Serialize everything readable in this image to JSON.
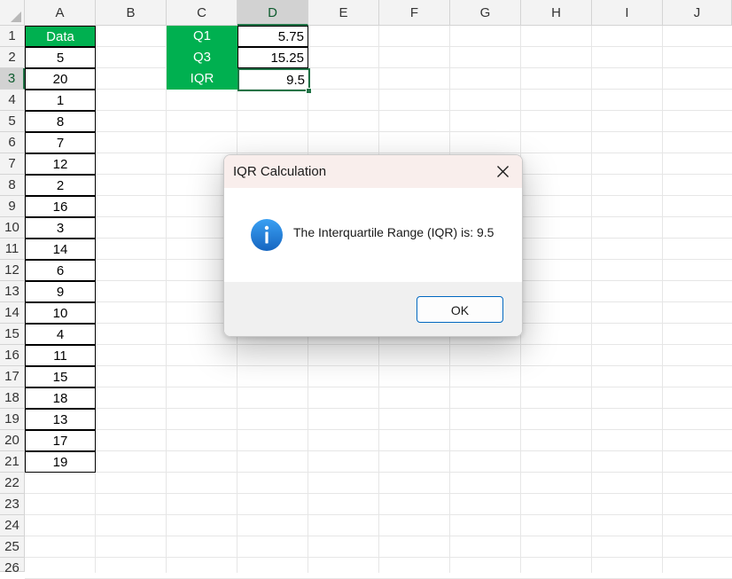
{
  "spreadsheet": {
    "columns": [
      "A",
      "B",
      "C",
      "D",
      "E",
      "F",
      "G",
      "H",
      "I",
      "J"
    ],
    "selected_column": "D",
    "rows": [
      "1",
      "2",
      "3",
      "4",
      "5",
      "6",
      "7",
      "8",
      "9",
      "10",
      "11",
      "12",
      "13",
      "14",
      "15",
      "16",
      "17",
      "18",
      "19",
      "20",
      "21",
      "22",
      "23",
      "24",
      "25",
      "26"
    ],
    "selected_row": "3",
    "column_a": {
      "header": "Data",
      "values": [
        "5",
        "20",
        "1",
        "8",
        "7",
        "12",
        "2",
        "16",
        "3",
        "14",
        "6",
        "9",
        "10",
        "4",
        "11",
        "15",
        "18",
        "13",
        "17",
        "19"
      ]
    },
    "summary": [
      {
        "label": "Q1",
        "value": "5.75"
      },
      {
        "label": "Q3",
        "value": "15.25"
      },
      {
        "label": "IQR",
        "value": "9.5"
      }
    ]
  },
  "dialog": {
    "title": "IQR Calculation",
    "message": "The Interquartile Range (IQR) is: 9.5",
    "ok_label": "OK",
    "icon": "info-icon",
    "close_icon": "close-icon"
  },
  "colors": {
    "header_fill": "#00b050",
    "selection": "#217346",
    "info_icon": "#1e88e5"
  }
}
